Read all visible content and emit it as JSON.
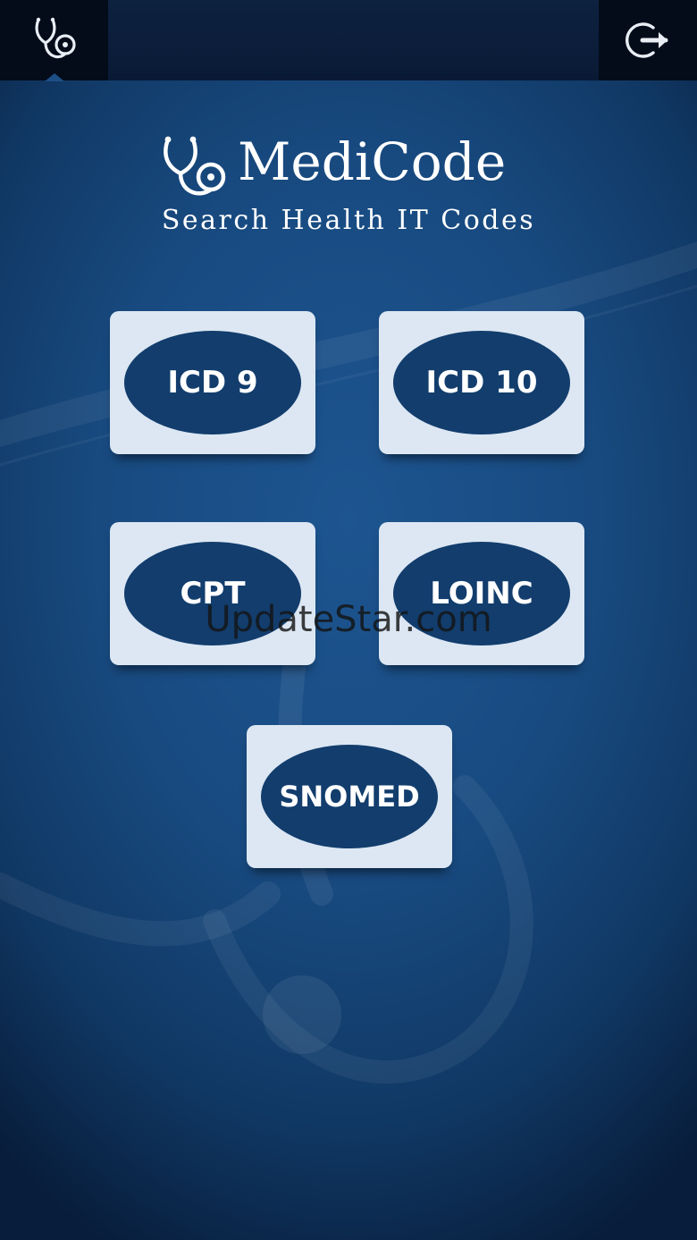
{
  "app": {
    "title": "MediCode",
    "subtitle": "Search Health IT Codes"
  },
  "topbar": {
    "left_icon": "stethoscope-icon",
    "right_icon": "logout-icon"
  },
  "codes": [
    {
      "label": "ICD 9"
    },
    {
      "label": "ICD 10"
    },
    {
      "label": "CPT"
    },
    {
      "label": "LOINC"
    },
    {
      "label": "SNOMED"
    }
  ],
  "watermark": "UpdateStar.com",
  "colors": {
    "background": "#184a80",
    "button_bg": "#dce7f3",
    "oval": "#123d6d",
    "topbar": "#040c1a"
  }
}
